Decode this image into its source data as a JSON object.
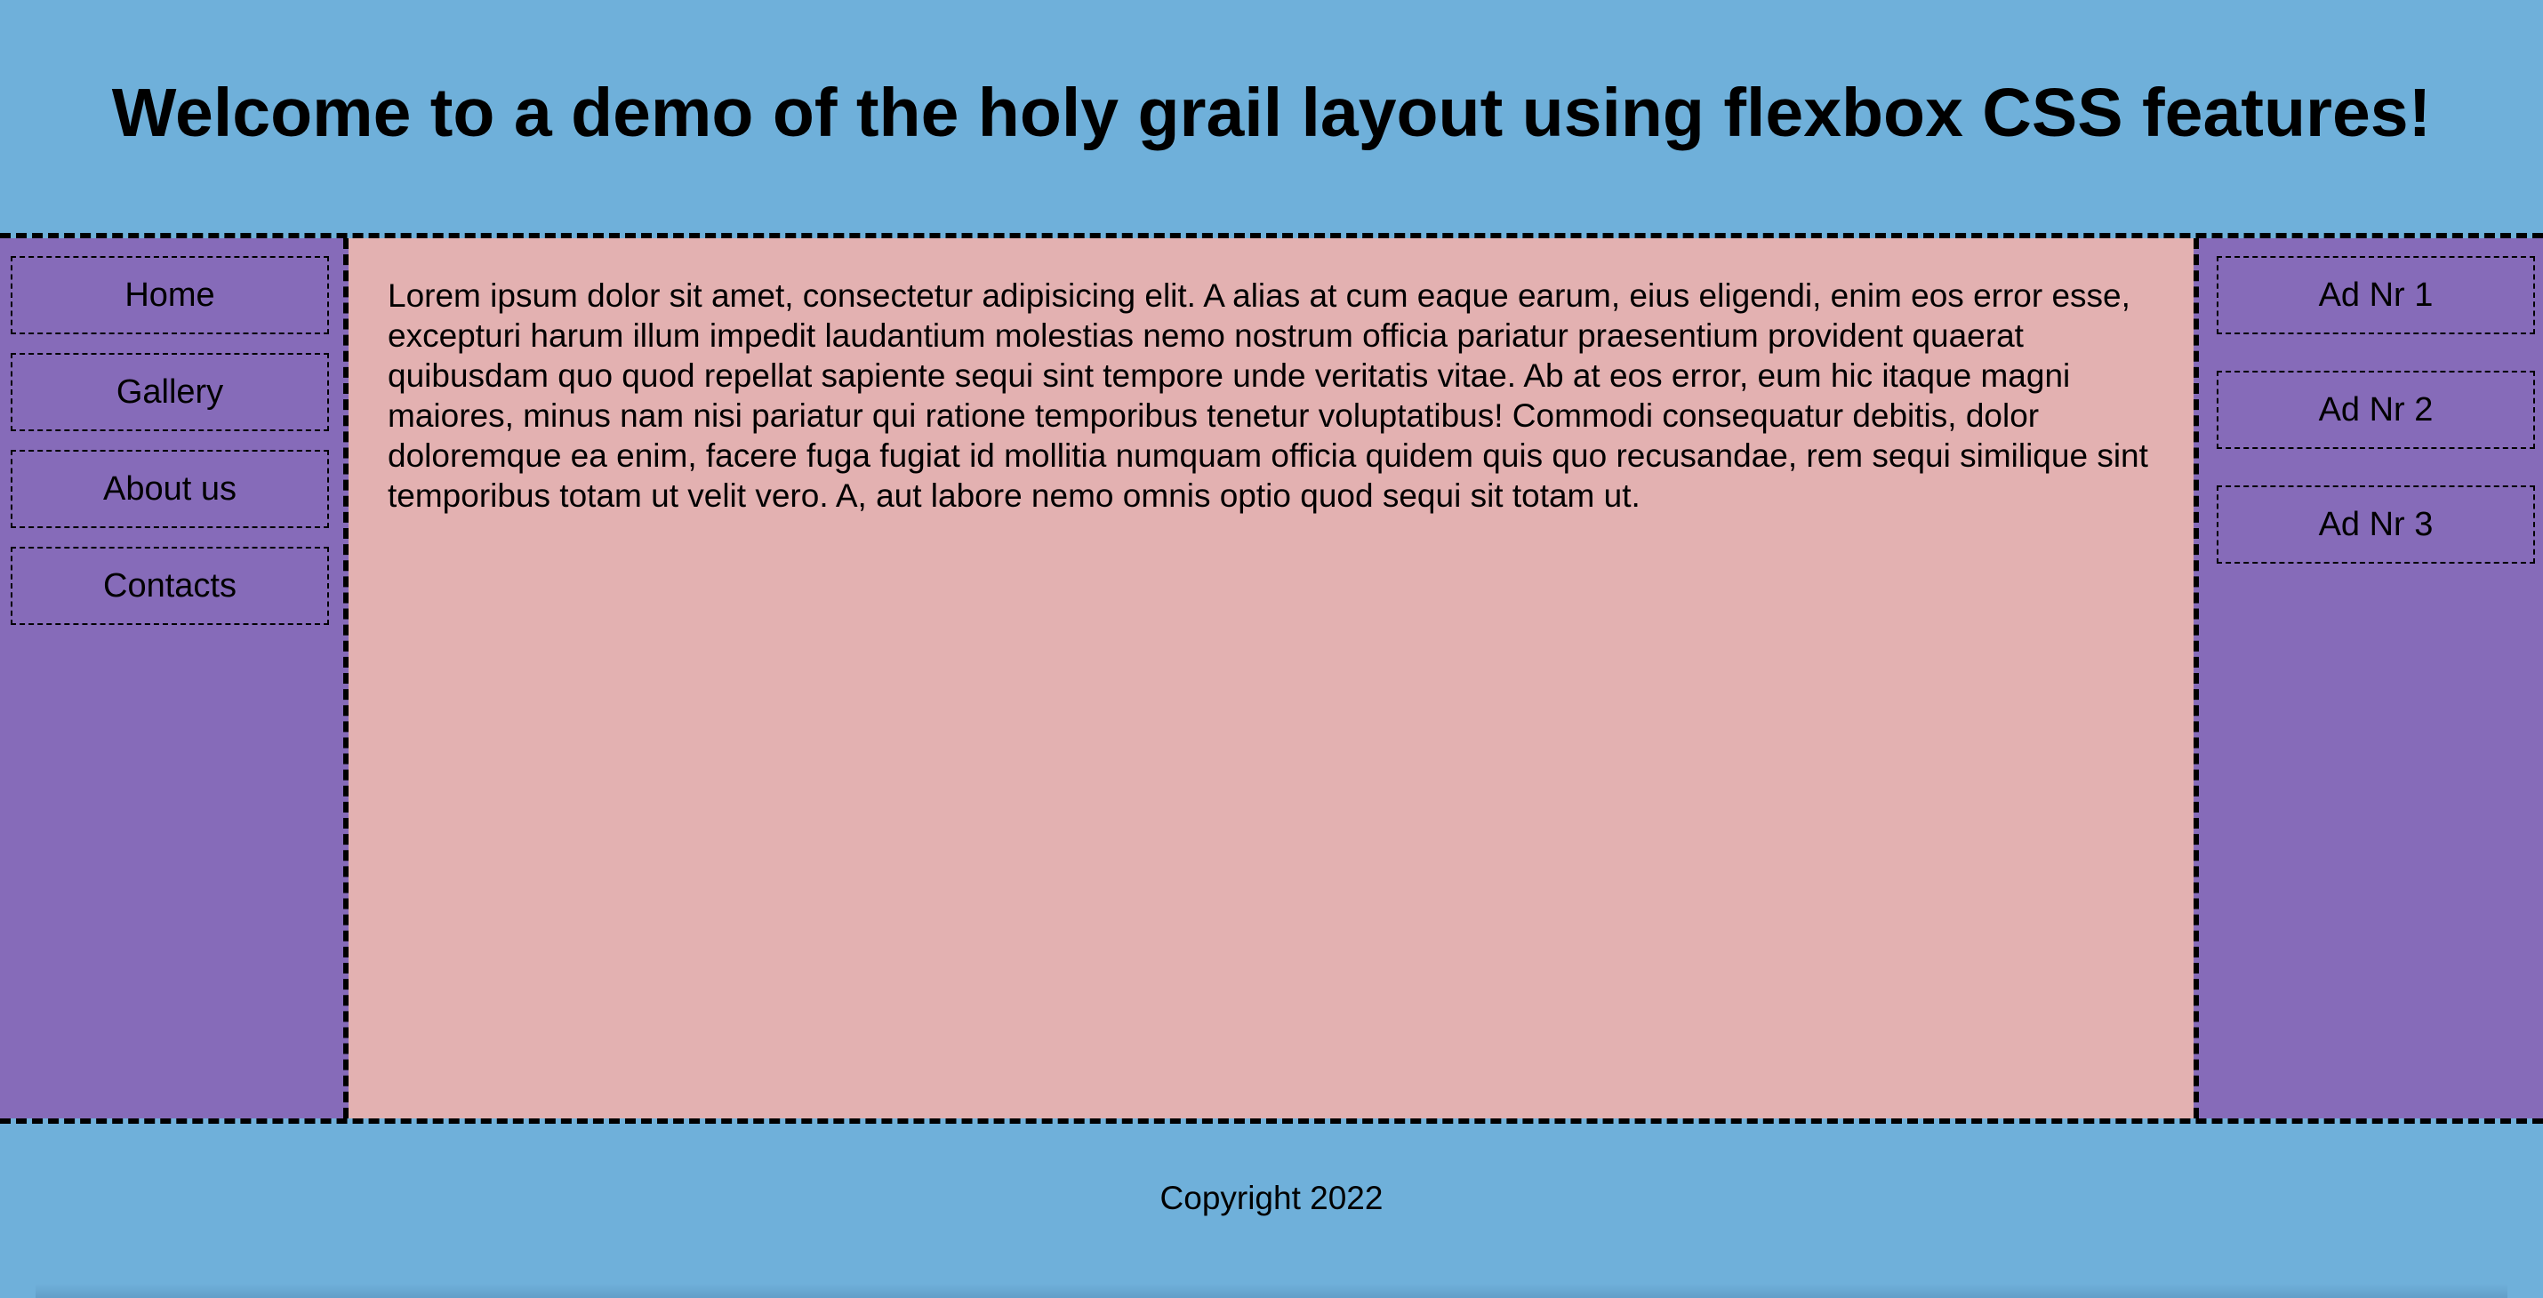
{
  "header": {
    "title": "Welcome to a demo of the holy grail layout using flexbox CSS features!"
  },
  "nav": {
    "items": [
      {
        "label": "Home"
      },
      {
        "label": "Gallery"
      },
      {
        "label": "About us"
      },
      {
        "label": "Contacts"
      }
    ]
  },
  "main": {
    "text": "Lorem ipsum dolor sit amet, consectetur adipisicing elit. A alias at cum eaque earum, eius eligendi, enim eos error esse, excepturi harum illum impedit laudantium molestias nemo nostrum officia pariatur praesentium provident quaerat quibusdam quo quod repellat sapiente sequi sint tempore unde veritatis vitae. Ab at eos error, eum hic itaque magni maiores, minus nam nisi pariatur qui ratione temporibus tenetur voluptatibus! Commodi consequatur debitis, dolor doloremque ea enim, facere fuga fugiat id mollitia numquam officia quidem quis quo recusandae, rem sequi similique sint temporibus totam ut velit vero. A, aut labore nemo omnis optio quod sequi sit totam ut."
  },
  "ads": {
    "items": [
      {
        "label": "Ad Nr 1"
      },
      {
        "label": "Ad Nr 2"
      },
      {
        "label": "Ad Nr 3"
      }
    ]
  },
  "footer": {
    "copyright": "Copyright 2022"
  },
  "colors": {
    "header_footer_bg": "#6fb0da",
    "sidebar_bg": "#866bb9",
    "main_bg": "#e3b1b1"
  }
}
